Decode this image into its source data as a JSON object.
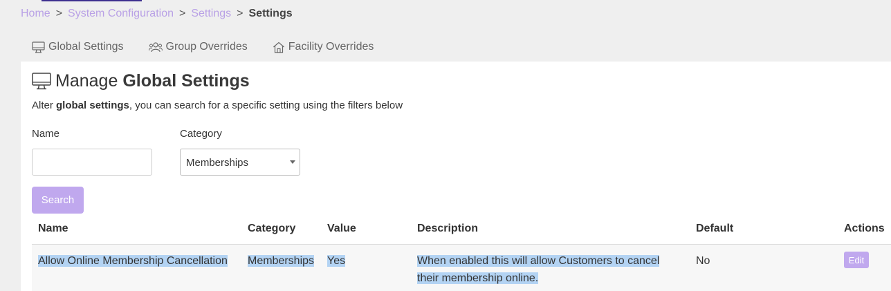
{
  "breadcrumb": {
    "items": [
      "Home",
      "System Configuration",
      "Settings"
    ],
    "current": "Settings",
    "separator": ">"
  },
  "tabs": [
    {
      "label": "Global Settings",
      "icon": "monitor-icon"
    },
    {
      "label": "Group Overrides",
      "icon": "users-icon"
    },
    {
      "label": "Facility Overrides",
      "icon": "home-icon"
    }
  ],
  "page": {
    "title_prefix": "Manage",
    "title_strong": "Global Settings",
    "subtitle_prefix": "Alter",
    "subtitle_strong": "global settings",
    "subtitle_suffix": ", you can search for a specific setting using the filters below"
  },
  "filters": {
    "name_label": "Name",
    "name_value": "",
    "category_label": "Category",
    "category_value": "Memberships",
    "search_label": "Search"
  },
  "table": {
    "headers": [
      "Name",
      "Category",
      "Value",
      "Description",
      "Default",
      "Actions"
    ],
    "rows": [
      {
        "name": "Allow Online Membership Cancellation",
        "category": "Memberships",
        "value": "Yes",
        "description_line1": "When enabled this will allow Customers to cancel",
        "description_line2": "their membership online.",
        "default": "No",
        "action": "Edit"
      }
    ]
  },
  "colors": {
    "accent": "#c0a8ee",
    "breadcrumb_link": "#b9a1e6",
    "selection_highlight": "#b3d3f3",
    "background": "#efefef"
  }
}
